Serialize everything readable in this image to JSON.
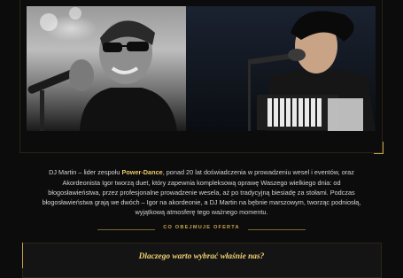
{
  "photos": {
    "left": {
      "alt": "DJ Martin singing with microphone"
    },
    "right": {
      "alt": "Igor playing accordion and singing"
    }
  },
  "description": {
    "lead": "DJ Martin – lider zespołu",
    "band": "Power-Dance",
    "rest": ", ponad 20 lat doświadczenia w prowadzeniu wesel i eventów, oraz Akordeonista Igor tworzą duet, który zapewnia kompleksową oprawę Waszego wielkiego dnia: od błogosławieństwa, przez profesjonalne prowadzenie wesela, aż po tradycyjną biesiadę za stołami. Podczas błogosławieństwa grają we dwóch – Igor na akordeonie, a DJ Martin na bębnie marszowym, tworząc podniosłą, wyjątkową atmosferę tego ważnego momentu."
  },
  "offer_section": {
    "label": "CO OBEJMUJE OFERTA"
  },
  "why_card": {
    "title": "Dlaczego warto wybrać właśnie nas?"
  },
  "colors": {
    "gold": "#c9a44c",
    "gold_light": "#f0d272",
    "background": "#0c0c0c"
  }
}
